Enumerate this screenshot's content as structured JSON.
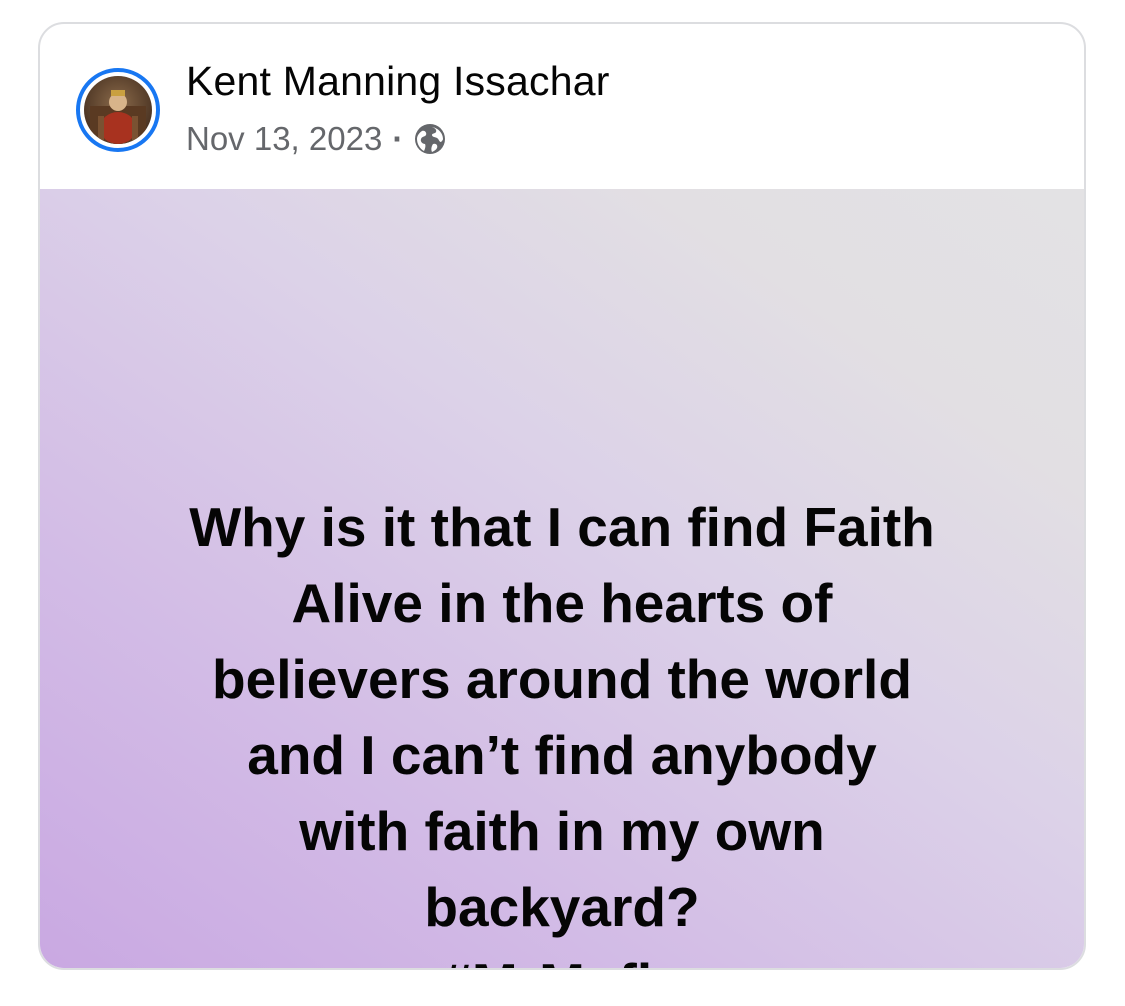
{
  "post": {
    "author": "Kent Manning Issachar",
    "date": "Nov 13, 2023",
    "separator": "·",
    "privacy_icon": "globe-icon",
    "body_lines": [
      "Why is it that I can find Faith",
      "Alive in the hearts of",
      "believers around the world",
      "and I can’t find anybody",
      "with faith in my own",
      "backyard?"
    ],
    "hashtag_prefix": "#",
    "hashtag_word": "MrMofia"
  },
  "colors": {
    "avatar_ring": "#1877f2",
    "author_text": "#050505",
    "meta_text": "#65676b",
    "bg_gradient_start": "#c9a8e2",
    "bg_gradient_end": "#e3e2e4"
  }
}
